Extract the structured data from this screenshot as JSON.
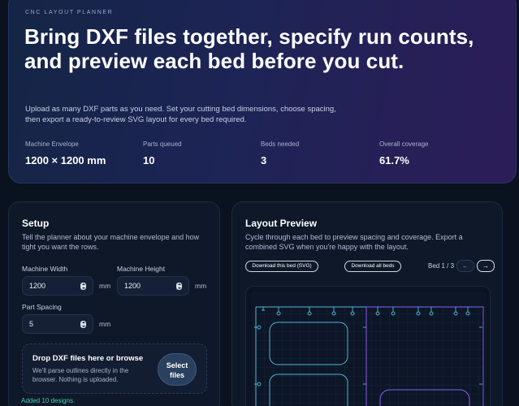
{
  "hero": {
    "eyebrow": "CNC LAYOUT PLANNER",
    "title": "Bring DXF files together, specify run counts, and preview each bed before you cut.",
    "description": "Upload as many DXF parts as you need. Set your cutting bed dimensions, choose spacing, then export a ready-to-review SVG layout for every bed required.",
    "stats": [
      {
        "label": "Machine Envelope",
        "value": "1200 × 1200 mm"
      },
      {
        "label": "Parts queued",
        "value": "10"
      },
      {
        "label": "Beds needed",
        "value": "3"
      },
      {
        "label": "Overall coverage",
        "value": "61.7%"
      }
    ]
  },
  "setup": {
    "title": "Setup",
    "description": "Tell the planner about your machine envelope and how tight you want the rows.",
    "width_label": "Machine Width",
    "width_value": "1200",
    "height_label": "Machine Height",
    "height_value": "1200",
    "spacing_label": "Part Spacing",
    "spacing_value": "5",
    "unit": "mm",
    "drop_title": "Drop DXF files here or browse",
    "drop_sub": "We'll parse outlines directly in the browser. Nothing is uploaded.",
    "select_label": "Select files",
    "status": "Added 10 designs."
  },
  "preview": {
    "title": "Layout Preview",
    "description": "Cycle through each bed to preview spacing and coverage. Export a combined SVG when you're happy with the layout.",
    "download_bed": "Download this bed (SVG)",
    "download_all": "Download all beds",
    "bed_indicator": "Bed 1 / 3",
    "prev_icon": "←",
    "next_icon": "→"
  },
  "colors": {
    "accent_teal": "#3fd0a8",
    "outline_cyan": "#4fb6d8",
    "outline_purple": "#8b5cf6"
  }
}
